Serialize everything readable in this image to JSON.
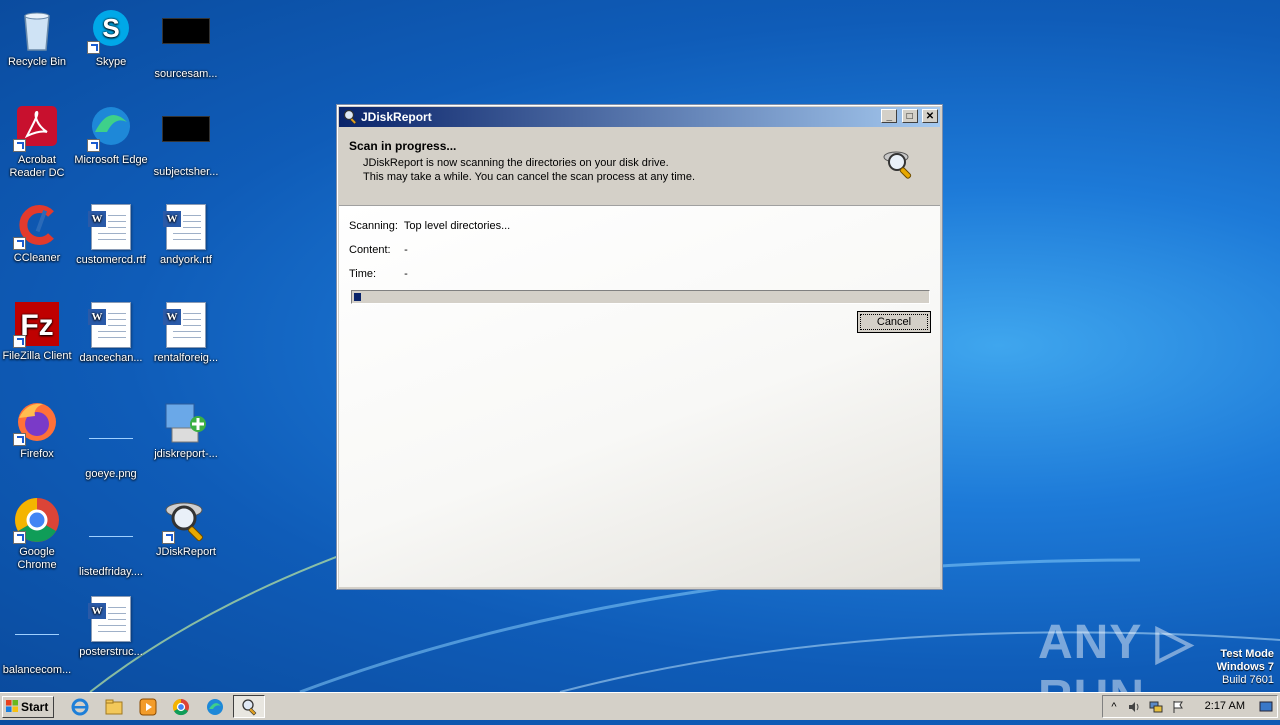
{
  "desktop": {
    "icons": [
      {
        "label": "Recycle Bin",
        "icon": "recycle-bin-icon"
      },
      {
        "label": "Skype",
        "icon": "skype-icon"
      },
      {
        "label": "sourcesam...",
        "icon": "black-thumbnail-icon"
      },
      {
        "label": "Acrobat\nReader DC",
        "icon": "acrobat-icon"
      },
      {
        "label": "Microsoft Edge",
        "icon": "edge-icon"
      },
      {
        "label": "subjectsher...",
        "icon": "black-thumbnail-icon"
      },
      {
        "label": "CCleaner",
        "icon": "ccleaner-icon"
      },
      {
        "label": "customercd.rtf",
        "icon": "word-document-icon"
      },
      {
        "label": "andyork.rtf",
        "icon": "word-document-icon"
      },
      {
        "label": "FileZilla Client",
        "icon": "filezilla-icon"
      },
      {
        "label": "dancechan...",
        "icon": "word-document-icon"
      },
      {
        "label": "rentalforeig...",
        "icon": "word-document-icon"
      },
      {
        "label": "Firefox",
        "icon": "firefox-icon"
      },
      {
        "label": "goeye.png",
        "icon": "blank-thumbnail-icon"
      },
      {
        "label": "jdiskreport-...",
        "icon": "installer-icon"
      },
      {
        "label": "Google\nChrome",
        "icon": "chrome-icon"
      },
      {
        "label": "listedfriday....",
        "icon": "blank-thumbnail-icon"
      },
      {
        "label": "JDiskReport",
        "icon": "jdiskreport-icon"
      },
      {
        "label": "balancecom...",
        "icon": "blank-thumbnail-icon"
      },
      {
        "label": "posterstruc...",
        "icon": "word-document-icon"
      }
    ]
  },
  "window": {
    "title": "JDiskReport",
    "header_title": "Scan in progress...",
    "desc_line1": "JDiskReport is now scanning the directories on your disk drive.",
    "desc_line2": "This may take a while. You can cancel the scan process at any time.",
    "scanning_label": "Scanning:",
    "scanning_value": "Top level directories...",
    "content_label": "Content:",
    "content_value": "-",
    "time_label": "Time:",
    "time_value": "-",
    "progress_fraction": 0.012,
    "cancel_label": "Cancel",
    "minimize_glyph": "_",
    "maximize_glyph": "□",
    "close_glyph": "✕"
  },
  "watermark": {
    "brand": "ANY ▷ RUN",
    "test_mode": "Test Mode",
    "os": "Windows 7",
    "build": "Build 7601"
  },
  "taskbar": {
    "start_label": "Start",
    "quicklaunch": [
      "internet-explorer-icon",
      "file-explorer-icon",
      "media-player-icon",
      "chrome-icon",
      "edge-icon"
    ],
    "active_app": "jdiskreport-icon",
    "clock": "2:17 AM"
  }
}
